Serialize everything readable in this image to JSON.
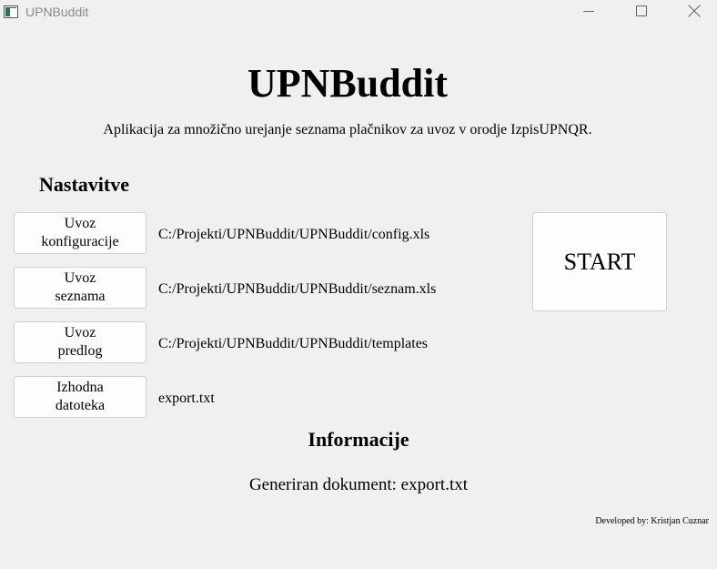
{
  "window": {
    "title": "UPNBuddit",
    "controls": [
      "minimize-icon",
      "maximize-icon",
      "close-icon"
    ]
  },
  "header": {
    "title": "UPNBuddit",
    "subtitle": "Aplikacija za množično urejanje seznama plačnikov za uvoz v orodje IzpisUPNQR."
  },
  "settings": {
    "heading": "Nastavitve",
    "rows": [
      {
        "button_label": "Uvoz\nkonfiguracije",
        "path": "C:/Projekti/UPNBuddit/UPNBuddit/config.xls"
      },
      {
        "button_label": "Uvoz\nseznama",
        "path": "C:/Projekti/UPNBuddit/UPNBuddit/seznam.xls"
      },
      {
        "button_label": "Uvoz\npredlog",
        "path": "C:/Projekti/UPNBuddit/UPNBuddit/templates"
      },
      {
        "button_label": "Izhodna\ndatoteka",
        "path": "export.txt"
      }
    ]
  },
  "actions": {
    "start_label": "START"
  },
  "info": {
    "heading": "Informacije",
    "generated_text": "Generiran dokument: export.txt"
  },
  "footer": {
    "developer": "Developed by: Kristjan Cuznar"
  },
  "colors": {
    "background": "#f0f0f0",
    "button_face": "#fdfdfd",
    "button_border": "#d0d0d0",
    "titlebar_text": "#8a8a8a"
  }
}
